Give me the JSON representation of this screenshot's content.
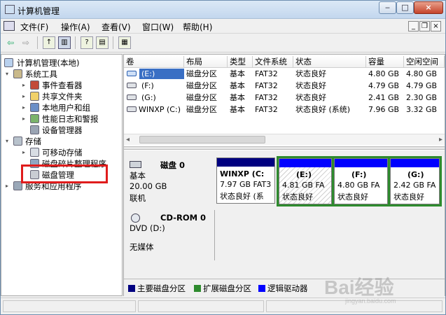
{
  "window": {
    "title": "计算机管理",
    "min_label": "‒",
    "max_label": "□",
    "close_label": "×"
  },
  "menu": {
    "items": [
      "文件(F)",
      "操作(A)",
      "查看(V)",
      "窗口(W)",
      "帮助(H)"
    ],
    "mdi": [
      "_",
      "❐",
      "×"
    ]
  },
  "toolbar": {
    "back": "⇦",
    "forward": "⇨"
  },
  "tree": {
    "root": "计算机管理(本地)",
    "system_tools": "系统工具",
    "event_viewer": "事件查看器",
    "shared_folders": "共享文件夹",
    "local_users": "本地用户和组",
    "perf_logs": "性能日志和警报",
    "device_manager": "设备管理器",
    "storage": "存储",
    "removable": "可移动存储",
    "defrag": "磁盘碎片整理程序",
    "disk_mgmt": "磁盘管理",
    "services": "服务和应用程序",
    "expanded": "▾",
    "collapsed": "▸"
  },
  "volumes": {
    "headers": [
      "卷",
      "布局",
      "类型",
      "文件系统",
      "状态",
      "容量",
      "空闲空间"
    ],
    "rows": [
      [
        "(E:)",
        "磁盘分区",
        "基本",
        "FAT32",
        "状态良好",
        "4.80 GB",
        "4.80 GB"
      ],
      [
        "(F:)",
        "磁盘分区",
        "基本",
        "FAT32",
        "状态良好",
        "4.79 GB",
        "4.79 GB"
      ],
      [
        "(G:)",
        "磁盘分区",
        "基本",
        "FAT32",
        "状态良好",
        "2.41 GB",
        "2.30 GB"
      ],
      [
        "WINXP (C:)",
        "磁盘分区",
        "基本",
        "FAT32",
        "状态良好 (系统)",
        "7.96 GB",
        "3.32 GB"
      ]
    ]
  },
  "scroll": {
    "left": "◂",
    "right": "▸"
  },
  "disk0": {
    "name": "磁盘 0",
    "type": "基本",
    "size": "20.00 GB",
    "status": "联机"
  },
  "partitions": [
    {
      "name": "WINXP (C:",
      "size": "7.97 GB FAT3",
      "status": "状态良好 (系"
    },
    {
      "name": "(E:)",
      "size": "4.81 GB FA",
      "status": "状态良好"
    },
    {
      "name": "(F:)",
      "size": "4.80 GB FA",
      "status": "状态良好"
    },
    {
      "name": "(G:)",
      "size": "2.42 GB FA",
      "status": "状态良好"
    }
  ],
  "cdrom": {
    "name": "CD-ROM 0",
    "type": "DVD (D:)",
    "media": "无媒体"
  },
  "legend": [
    {
      "label": "主要磁盘分区",
      "color": "#000080"
    },
    {
      "label": "扩展磁盘分区",
      "color": "#2e8b2e"
    },
    {
      "label": "逻辑驱动器",
      "color": "#0000ff"
    }
  ],
  "watermark": {
    "brand": "Bai经验",
    "url": "jingyan.baidu.com"
  },
  "colors": {
    "primary_partition": "#000080",
    "extended_partition": "#2e8b2e",
    "logical_drive": "#0000ff",
    "highlight_box": "#e01c1c"
  }
}
